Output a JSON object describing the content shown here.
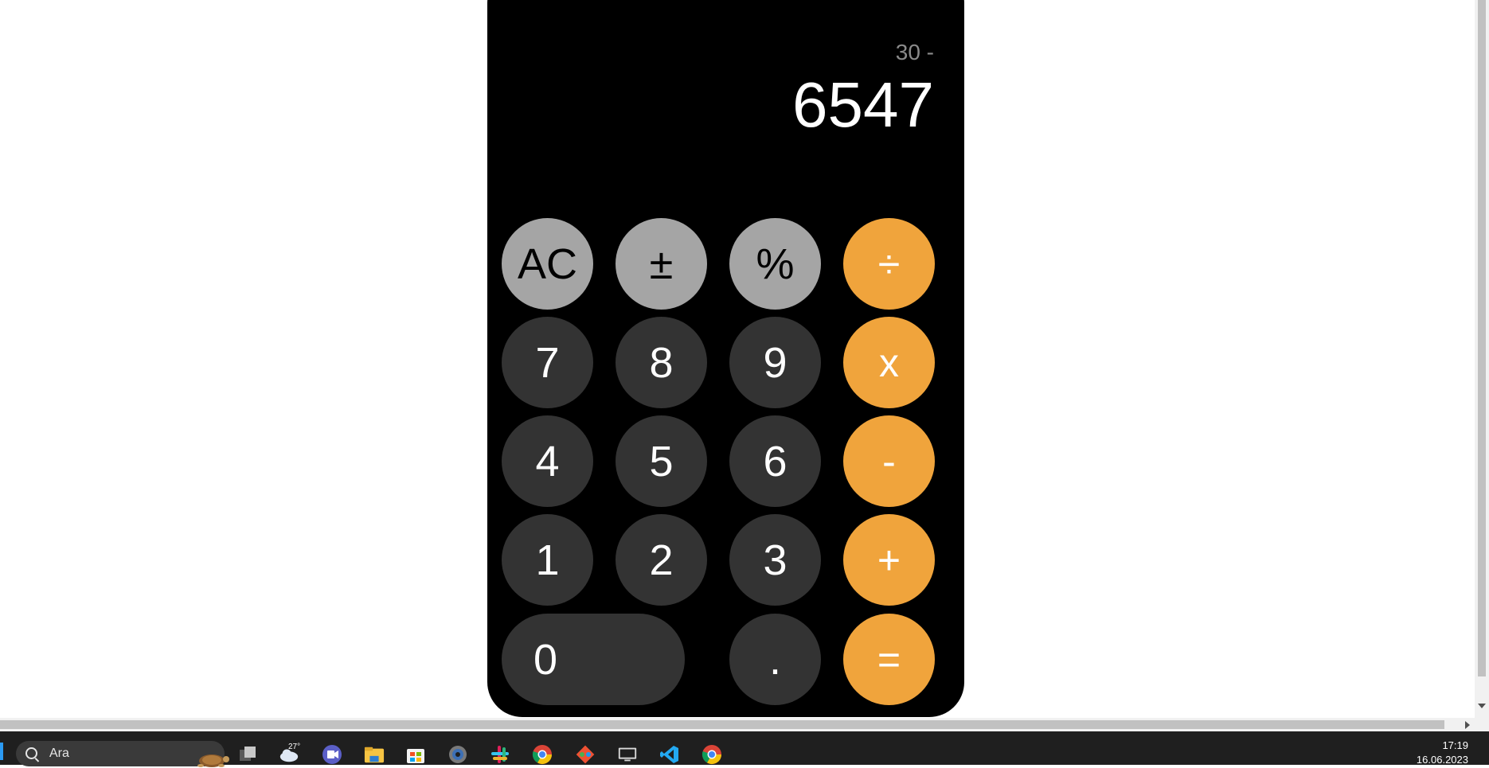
{
  "calculator": {
    "history": "30 -",
    "display": "6547",
    "keys": {
      "ac": "AC",
      "sign": "±",
      "percent": "%",
      "divide": "÷",
      "seven": "7",
      "eight": "8",
      "nine": "9",
      "multiply": "x",
      "four": "4",
      "five": "5",
      "six": "6",
      "minus": "-",
      "one": "1",
      "two": "2",
      "three": "3",
      "plus": "+",
      "zero": "0",
      "decimal": ".",
      "equals": "="
    },
    "colors": {
      "body": "#000000",
      "function_key": "#a5a5a5",
      "number_key": "#333333",
      "operator_key": "#f0a43c"
    }
  },
  "taskbar": {
    "search_text": "Ara",
    "weather_temp": "27°",
    "time": "17:19",
    "date": "16.06.2023",
    "icons": [
      "task-view-icon",
      "weather-icon",
      "teams-icon",
      "file-explorer-icon",
      "store-icon",
      "settings-icon",
      "slack-icon",
      "chrome-icon",
      "git-icon",
      "remote-desktop-icon",
      "vscode-icon",
      "chrome-icon"
    ]
  }
}
